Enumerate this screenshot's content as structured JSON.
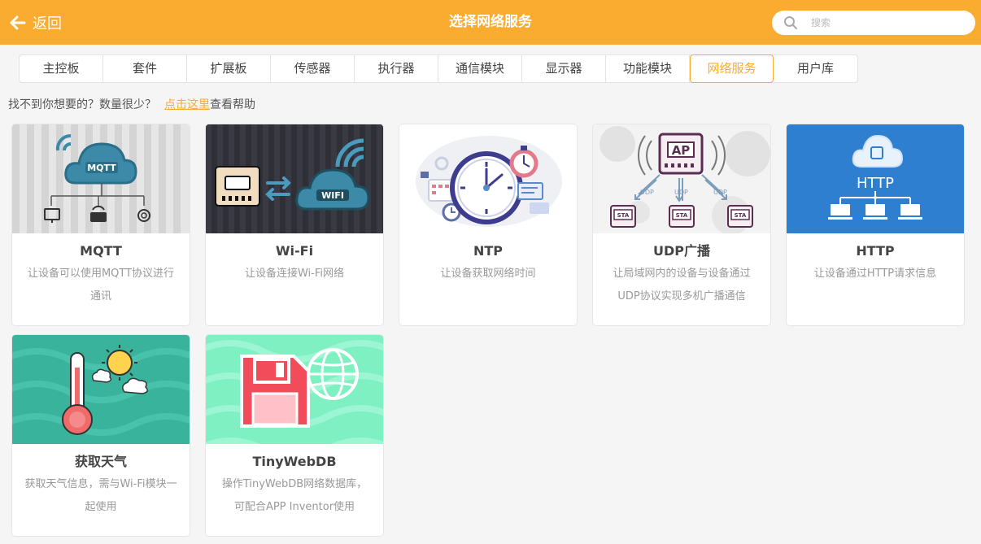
{
  "header": {
    "back_label": "返回",
    "title": "选择网络服务",
    "search_placeholder": "搜索",
    "search_value": ""
  },
  "tabs": [
    {
      "label": "主控板",
      "active": false
    },
    {
      "label": "套件",
      "active": false
    },
    {
      "label": "扩展板",
      "active": false
    },
    {
      "label": "传感器",
      "active": false
    },
    {
      "label": "执行器",
      "active": false
    },
    {
      "label": "通信模块",
      "active": false
    },
    {
      "label": "显示器",
      "active": false
    },
    {
      "label": "功能模块",
      "active": false
    },
    {
      "label": "网络服务",
      "active": true
    },
    {
      "label": "用户库",
      "active": false
    }
  ],
  "help": {
    "text": "找不到你想要的？数量很少？",
    "link": "点击这里",
    "suffix": "查看帮助"
  },
  "cards": [
    {
      "name": "MQTT",
      "desc": "让设备可以使用MQTT协议进行通讯",
      "icon": "mqtt-cloud"
    },
    {
      "name": "Wi-Fi",
      "desc": "让设备连接Wi-Fi网络",
      "icon": "wifi-cloud"
    },
    {
      "name": "NTP",
      "desc": "让设备获取网络时间",
      "icon": "clock"
    },
    {
      "name": "UDP广播",
      "desc": "让局域网内的设备与设备通过UDP协议实现多机广播通信",
      "icon": "udp-broadcast"
    },
    {
      "name": "HTTP",
      "desc": "让设备通过HTTP请求信息",
      "icon": "http-cloud"
    },
    {
      "name": "获取天气",
      "desc": "获取天气信息，需与Wi-Fi模块一起使用",
      "icon": "weather"
    },
    {
      "name": "TinyWebDB",
      "desc": "操作TinyWebDB网络数据库，可配合APP Inventor使用",
      "icon": "database-globe"
    }
  ],
  "thumb_text": {
    "mqtt": "MQTT",
    "wifi": "WIFI",
    "ap": "AP",
    "udp": "UDP",
    "sta": "STA",
    "http": "HTTP"
  },
  "colors": {
    "accent": "#f9ac2f",
    "header_text": "#ffffff",
    "http_blue": "#2e7fd0",
    "weather_teal": "#3ab39d",
    "db_mint": "#7ff0c2",
    "wifi_dark": "#2f2f38"
  }
}
